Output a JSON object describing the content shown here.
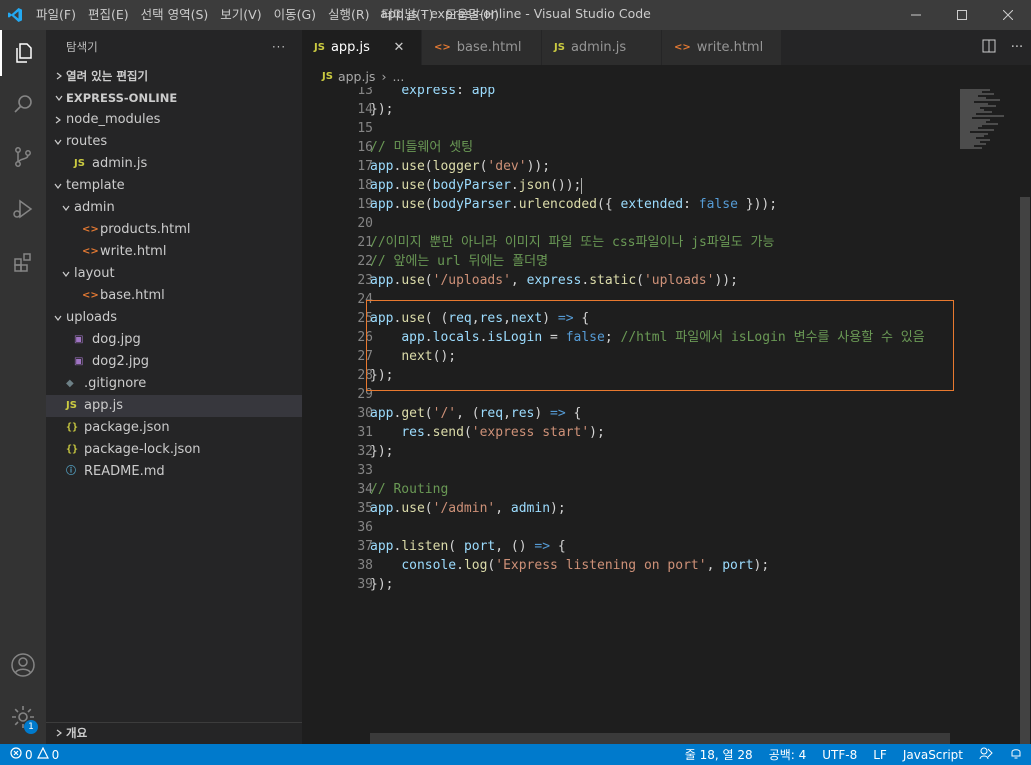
{
  "window": {
    "title": "app.js - express-online - Visual Studio Code",
    "menu": [
      "파일(F)",
      "편집(E)",
      "선택 영역(S)",
      "보기(V)",
      "이동(G)",
      "실행(R)",
      "터미널(T)",
      "도움말(H)"
    ]
  },
  "sidebar": {
    "title": "탐색기",
    "more": "···",
    "open_editors": "열려 있는 편집기",
    "project": "EXPRESS-ONLINE",
    "outline": "개요",
    "tree": [
      {
        "label": "node_modules",
        "type": "folder-closed"
      },
      {
        "label": "routes",
        "type": "folder-open"
      },
      {
        "label": "admin.js",
        "type": "js"
      },
      {
        "label": "template",
        "type": "folder-open"
      },
      {
        "label": "admin",
        "type": "folder-open"
      },
      {
        "label": "products.html",
        "type": "html"
      },
      {
        "label": "write.html",
        "type": "html"
      },
      {
        "label": "layout",
        "type": "folder-open"
      },
      {
        "label": "base.html",
        "type": "html"
      },
      {
        "label": "uploads",
        "type": "folder-open"
      },
      {
        "label": "dog.jpg",
        "type": "image"
      },
      {
        "label": "dog2.jpg",
        "type": "image"
      },
      {
        "label": ".gitignore",
        "type": "git"
      },
      {
        "label": "app.js",
        "type": "js",
        "selected": true
      },
      {
        "label": "package.json",
        "type": "json"
      },
      {
        "label": "package-lock.json",
        "type": "json"
      },
      {
        "label": "README.md",
        "type": "info"
      }
    ]
  },
  "tabs": [
    {
      "label": "app.js",
      "icon": "JS",
      "active": true,
      "close": "✕"
    },
    {
      "label": "base.html",
      "icon": "<>",
      "active": false
    },
    {
      "label": "admin.js",
      "icon": "JS",
      "active": false
    },
    {
      "label": "write.html",
      "icon": "<>",
      "active": false
    }
  ],
  "breadcrumb": {
    "file": "app.js",
    "sep": "›",
    "rest": "..."
  },
  "code": [
    {
      "n": "13",
      "tokens": [
        [
          "    ",
          ""
        ],
        [
          "express",
          "var"
        ],
        [
          ": ",
          ""
        ],
        [
          "app",
          "var"
        ]
      ]
    },
    {
      "n": "14",
      "tokens": [
        [
          "});",
          ""
        ]
      ]
    },
    {
      "n": "15",
      "tokens": []
    },
    {
      "n": "16",
      "tokens": [
        [
          "// 미들웨어 셋팅",
          "com"
        ]
      ]
    },
    {
      "n": "17",
      "tokens": [
        [
          "app",
          "var"
        ],
        [
          ".",
          ""
        ],
        [
          "use",
          "fn"
        ],
        [
          "(",
          ""
        ],
        [
          "logger",
          "fn"
        ],
        [
          "(",
          ""
        ],
        [
          "'dev'",
          "str"
        ],
        [
          "));",
          ""
        ]
      ]
    },
    {
      "n": "18",
      "tokens": [
        [
          "app",
          "var"
        ],
        [
          ".",
          ""
        ],
        [
          "use",
          "fn"
        ],
        [
          "(",
          ""
        ],
        [
          "bodyParser",
          "var"
        ],
        [
          ".",
          ""
        ],
        [
          "json",
          "fn"
        ],
        [
          "());",
          ""
        ]
      ],
      "cursor": true
    },
    {
      "n": "19",
      "tokens": [
        [
          "app",
          "var"
        ],
        [
          ".",
          ""
        ],
        [
          "use",
          "fn"
        ],
        [
          "(",
          ""
        ],
        [
          "bodyParser",
          "var"
        ],
        [
          ".",
          ""
        ],
        [
          "urlencoded",
          "fn"
        ],
        [
          "({ ",
          ""
        ],
        [
          "extended",
          "var"
        ],
        [
          ": ",
          ""
        ],
        [
          "false",
          "bool"
        ],
        [
          " }));",
          ""
        ]
      ]
    },
    {
      "n": "20",
      "tokens": []
    },
    {
      "n": "21",
      "tokens": [
        [
          "//이미지 뿐만 아니라 이미지 파일 또는 css파일이나 js파일도 가능",
          "com"
        ]
      ]
    },
    {
      "n": "22",
      "tokens": [
        [
          "// 앞에는 url 뒤에는 폴더명",
          "com"
        ]
      ]
    },
    {
      "n": "23",
      "tokens": [
        [
          "app",
          "var"
        ],
        [
          ".",
          ""
        ],
        [
          "use",
          "fn"
        ],
        [
          "(",
          ""
        ],
        [
          "'/uploads'",
          "str"
        ],
        [
          ", ",
          ""
        ],
        [
          "express",
          "var"
        ],
        [
          ".",
          ""
        ],
        [
          "static",
          "fn"
        ],
        [
          "(",
          ""
        ],
        [
          "'uploads'",
          "str"
        ],
        [
          "));",
          ""
        ]
      ]
    },
    {
      "n": "24",
      "tokens": []
    },
    {
      "n": "25",
      "tokens": [
        [
          "app",
          "var"
        ],
        [
          ".",
          ""
        ],
        [
          "use",
          "fn"
        ],
        [
          "( (",
          ""
        ],
        [
          "req",
          "var"
        ],
        [
          ",",
          ""
        ],
        [
          "res",
          "var"
        ],
        [
          ",",
          ""
        ],
        [
          "next",
          "var"
        ],
        [
          ") ",
          ""
        ],
        [
          "=>",
          "bool"
        ],
        [
          " {",
          ""
        ]
      ]
    },
    {
      "n": "26",
      "tokens": [
        [
          "    ",
          ""
        ],
        [
          "app",
          "var"
        ],
        [
          ".",
          ""
        ],
        [
          "locals",
          "var"
        ],
        [
          ".",
          ""
        ],
        [
          "isLogin",
          "var"
        ],
        [
          " = ",
          ""
        ],
        [
          "false",
          "bool"
        ],
        [
          "; ",
          ""
        ],
        [
          "//html 파일에서 isLogin 변수를 사용할 수 있음",
          "com"
        ]
      ]
    },
    {
      "n": "27",
      "tokens": [
        [
          "    ",
          ""
        ],
        [
          "next",
          "fn"
        ],
        [
          "();",
          ""
        ]
      ]
    },
    {
      "n": "28",
      "tokens": [
        [
          "});",
          ""
        ]
      ]
    },
    {
      "n": "29",
      "tokens": []
    },
    {
      "n": "30",
      "tokens": [
        [
          "app",
          "var"
        ],
        [
          ".",
          ""
        ],
        [
          "get",
          "fn"
        ],
        [
          "(",
          ""
        ],
        [
          "'/'",
          "str"
        ],
        [
          ", (",
          ""
        ],
        [
          "req",
          "var"
        ],
        [
          ",",
          ""
        ],
        [
          "res",
          "var"
        ],
        [
          ") ",
          ""
        ],
        [
          "=>",
          "bool"
        ],
        [
          " {",
          ""
        ]
      ]
    },
    {
      "n": "31",
      "tokens": [
        [
          "    ",
          ""
        ],
        [
          "res",
          "var"
        ],
        [
          ".",
          ""
        ],
        [
          "send",
          "fn"
        ],
        [
          "(",
          ""
        ],
        [
          "'express start'",
          "str"
        ],
        [
          ");",
          ""
        ]
      ]
    },
    {
      "n": "32",
      "tokens": [
        [
          "});",
          ""
        ]
      ]
    },
    {
      "n": "33",
      "tokens": []
    },
    {
      "n": "34",
      "tokens": [
        [
          "// Routing",
          "com"
        ]
      ]
    },
    {
      "n": "35",
      "tokens": [
        [
          "app",
          "var"
        ],
        [
          ".",
          ""
        ],
        [
          "use",
          "fn"
        ],
        [
          "(",
          ""
        ],
        [
          "'/admin'",
          "str"
        ],
        [
          ", ",
          ""
        ],
        [
          "admin",
          "var"
        ],
        [
          ");",
          ""
        ]
      ]
    },
    {
      "n": "36",
      "tokens": []
    },
    {
      "n": "37",
      "tokens": [
        [
          "app",
          "var"
        ],
        [
          ".",
          ""
        ],
        [
          "listen",
          "fn"
        ],
        [
          "( ",
          ""
        ],
        [
          "port",
          "var"
        ],
        [
          ", () ",
          ""
        ],
        [
          "=>",
          "bool"
        ],
        [
          " {",
          ""
        ]
      ]
    },
    {
      "n": "38",
      "tokens": [
        [
          "    ",
          ""
        ],
        [
          "console",
          "var"
        ],
        [
          ".",
          ""
        ],
        [
          "log",
          "fn"
        ],
        [
          "(",
          ""
        ],
        [
          "'Express listening on port'",
          "str"
        ],
        [
          ", ",
          ""
        ],
        [
          "port",
          "var"
        ],
        [
          ");",
          ""
        ]
      ]
    },
    {
      "n": "39",
      "tokens": [
        [
          "});",
          ""
        ]
      ]
    }
  ],
  "status": {
    "errors": "0",
    "warnings": "0",
    "position": "줄 18, 열 28",
    "spaces": "공백: 4",
    "encoding": "UTF-8",
    "eol": "LF",
    "language": "JavaScript",
    "settings_badge": "1"
  },
  "colors": {
    "accent": "#007acc",
    "highlight_border": "#e8792f"
  }
}
